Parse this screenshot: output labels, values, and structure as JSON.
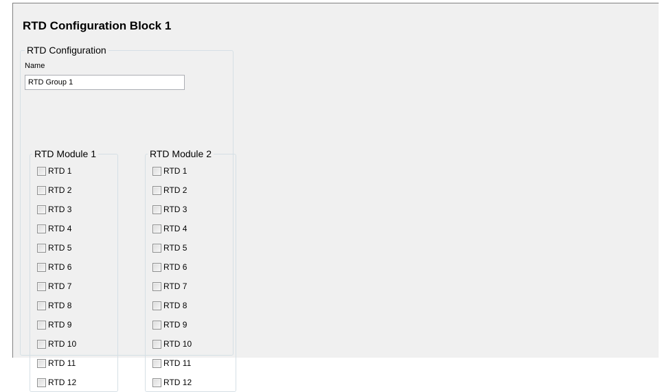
{
  "page": {
    "title": "RTD Configuration Block 1"
  },
  "config_group": {
    "legend": "RTD Configuration",
    "name_label": "Name",
    "name_value": "RTD Group 1"
  },
  "modules": [
    {
      "legend": "RTD Module 1",
      "items": [
        {
          "label": "RTD 1",
          "checked": false
        },
        {
          "label": "RTD 2",
          "checked": false
        },
        {
          "label": "RTD 3",
          "checked": false
        },
        {
          "label": "RTD 4",
          "checked": false
        },
        {
          "label": "RTD 5",
          "checked": false
        },
        {
          "label": "RTD 6",
          "checked": false
        },
        {
          "label": "RTD 7",
          "checked": false
        },
        {
          "label": "RTD 8",
          "checked": false
        },
        {
          "label": "RTD 9",
          "checked": false
        },
        {
          "label": "RTD 10",
          "checked": false
        },
        {
          "label": "RTD 11",
          "checked": false
        },
        {
          "label": "RTD 12",
          "checked": false
        }
      ]
    },
    {
      "legend": "RTD Module 2",
      "items": [
        {
          "label": "RTD 1",
          "checked": false
        },
        {
          "label": "RTD 2",
          "checked": false
        },
        {
          "label": "RTD 3",
          "checked": false
        },
        {
          "label": "RTD 4",
          "checked": false
        },
        {
          "label": "RTD 5",
          "checked": false
        },
        {
          "label": "RTD 6",
          "checked": false
        },
        {
          "label": "RTD 7",
          "checked": false
        },
        {
          "label": "RTD 8",
          "checked": false
        },
        {
          "label": "RTD 9",
          "checked": false
        },
        {
          "label": "RTD 10",
          "checked": false
        },
        {
          "label": "RTD 11",
          "checked": false
        },
        {
          "label": "RTD 12",
          "checked": false
        }
      ]
    }
  ]
}
